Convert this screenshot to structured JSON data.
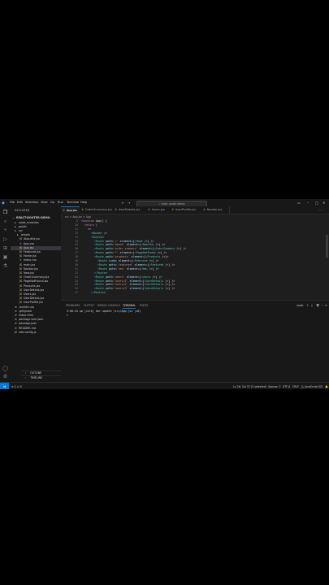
{
  "menu": {
    "items": [
      "File",
      "Edit",
      "Selection",
      "View",
      "Go",
      "Run",
      "Terminal",
      "Help"
    ],
    "search_placeholder": "react-router-demo"
  },
  "sidebar": {
    "header": "EXPLORER",
    "project": "REACT-ROUTER-DEMO",
    "tree": [
      {
        "label": "node_modules",
        "type": "folder",
        "depth": 1
      },
      {
        "label": "public",
        "type": "folder",
        "depth": 1
      },
      {
        "label": "src",
        "type": "folder",
        "depth": 1
      },
      {
        "label": "assets",
        "type": "folder",
        "depth": 2
      },
      {
        "label": "AboutUs.jsx",
        "type": "js",
        "depth": 3
      },
      {
        "label": "App.css",
        "type": "css",
        "depth": 3
      },
      {
        "label": "App.jsx",
        "type": "js",
        "depth": 3,
        "selected": true
      },
      {
        "label": "Featured.jsx",
        "type": "js",
        "depth": 3
      },
      {
        "label": "Home.jsx",
        "type": "js",
        "depth": 3
      },
      {
        "label": "index.css",
        "type": "css",
        "depth": 3
      },
      {
        "label": "main.jsx",
        "type": "js",
        "depth": 3
      },
      {
        "label": "Navbar.jsx",
        "type": "js",
        "depth": 3
      },
      {
        "label": "New.jsx",
        "type": "js",
        "depth": 3
      },
      {
        "label": "OrderSummary.jsx",
        "type": "js",
        "depth": 3
      },
      {
        "label": "PageNotFound.jsx",
        "type": "js",
        "depth": 3
      },
      {
        "label": "Products.jsx",
        "type": "js",
        "depth": 3
      },
      {
        "label": "UserDetails.jsx",
        "type": "js",
        "depth": 3
      },
      {
        "label": "Users.jsx",
        "type": "js",
        "depth": 3
      },
      {
        "label": "UserDetails.jsx",
        "type": "js",
        "depth": 3
      },
      {
        "label": "UserProfile.jsx",
        "type": "js",
        "depth": 3
      },
      {
        "label": ".eslintrc.cjs",
        "type": "file",
        "depth": 1
      },
      {
        "label": ".gitignore",
        "type": "file",
        "depth": 1
      },
      {
        "label": "index.html",
        "type": "file",
        "depth": 1
      },
      {
        "label": "package-lock.json",
        "type": "file",
        "depth": 1
      },
      {
        "label": "package.json",
        "type": "file",
        "depth": 1
      },
      {
        "label": "README.md",
        "type": "file",
        "depth": 1
      },
      {
        "label": "vite.config.js",
        "type": "js",
        "depth": 1
      }
    ],
    "outline": "OUTLINE",
    "timeline": "TIMELINE"
  },
  "tabs": [
    {
      "label": "App.jsx",
      "active": true
    },
    {
      "label": "OrderSummary.jsx",
      "active": false
    },
    {
      "label": "UserDetails.jsx",
      "active": false
    },
    {
      "label": "Users.jsx",
      "active": false
    },
    {
      "label": "UserProfile.jsx",
      "active": false
    },
    {
      "label": "Navbar.jsx",
      "active": false
    }
  ],
  "breadcrumb": "src > App.jsx > App",
  "editor": {
    "lines": [
      {
        "n": "9",
        "code": "function App() {"
      },
      {
        "n": "10",
        "code": "  return ("
      },
      {
        "n": "11",
        "code": "    <>"
      },
      {
        "n": "12",
        "code": "      <Navbar />"
      },
      {
        "n": "13",
        "code": "      <Routes>"
      },
      {
        "n": "14",
        "code": "        <Route path='/' element={<Home />} />"
      },
      {
        "n": "15",
        "code": "        <Route path='about' element={<AboutUs />} />"
      },
      {
        "n": "16",
        "code": "        <Route path='order-summary' element={<OrderSummary />} />"
      },
      {
        "n": "17",
        "code": "        <Route path='*' element={<PageNotFound />} />"
      },
      {
        "n": "18",
        "code": "        <Route path='products' element={<Products />}>"
      },
      {
        "n": "19",
        "code": "          <Route index element={<Featured />} />"
      },
      {
        "n": "20",
        "code": "          <Route path='featured' element={<Featured />} />"
      },
      {
        "n": "21",
        "code": "          <Route path='new' element={<New />} />"
      },
      {
        "n": "22",
        "code": "        </Route>"
      },
      {
        "n": "23",
        "code": "        <Route path='users' element={<Users />} />"
      },
      {
        "n": "24",
        "code": "        <Route path='users/1' element={<UserDetails />} />"
      },
      {
        "n": "25",
        "code": "        <Route path='users/2' element={<UserDetails />} />"
      },
      {
        "n": "26",
        "code": "        <Route path='users/3' element={<UserDetails />} />"
      },
      {
        "n": "27",
        "code": "      </Routes>"
      }
    ]
  },
  "panel": {
    "tabs": [
      "PROBLEMS",
      "OUTPUT",
      "DEBUG CONSOLE",
      "TERMINAL",
      "PORTS"
    ],
    "active_tab": "TERMINAL",
    "shell": "node",
    "terminal_lines": [
      "5:00:44 pm [vite] hmr update /src/App.jsx (x8)",
      ">"
    ]
  },
  "status": {
    "position": "Ln 26, Col 57 (5 selected)",
    "spaces": "Spaces: 2",
    "encoding": "UTF-8",
    "eol": "CRLF",
    "language": "{} JavaScript JSX",
    "warnings": "⊗ 0 ⚠ 0"
  }
}
